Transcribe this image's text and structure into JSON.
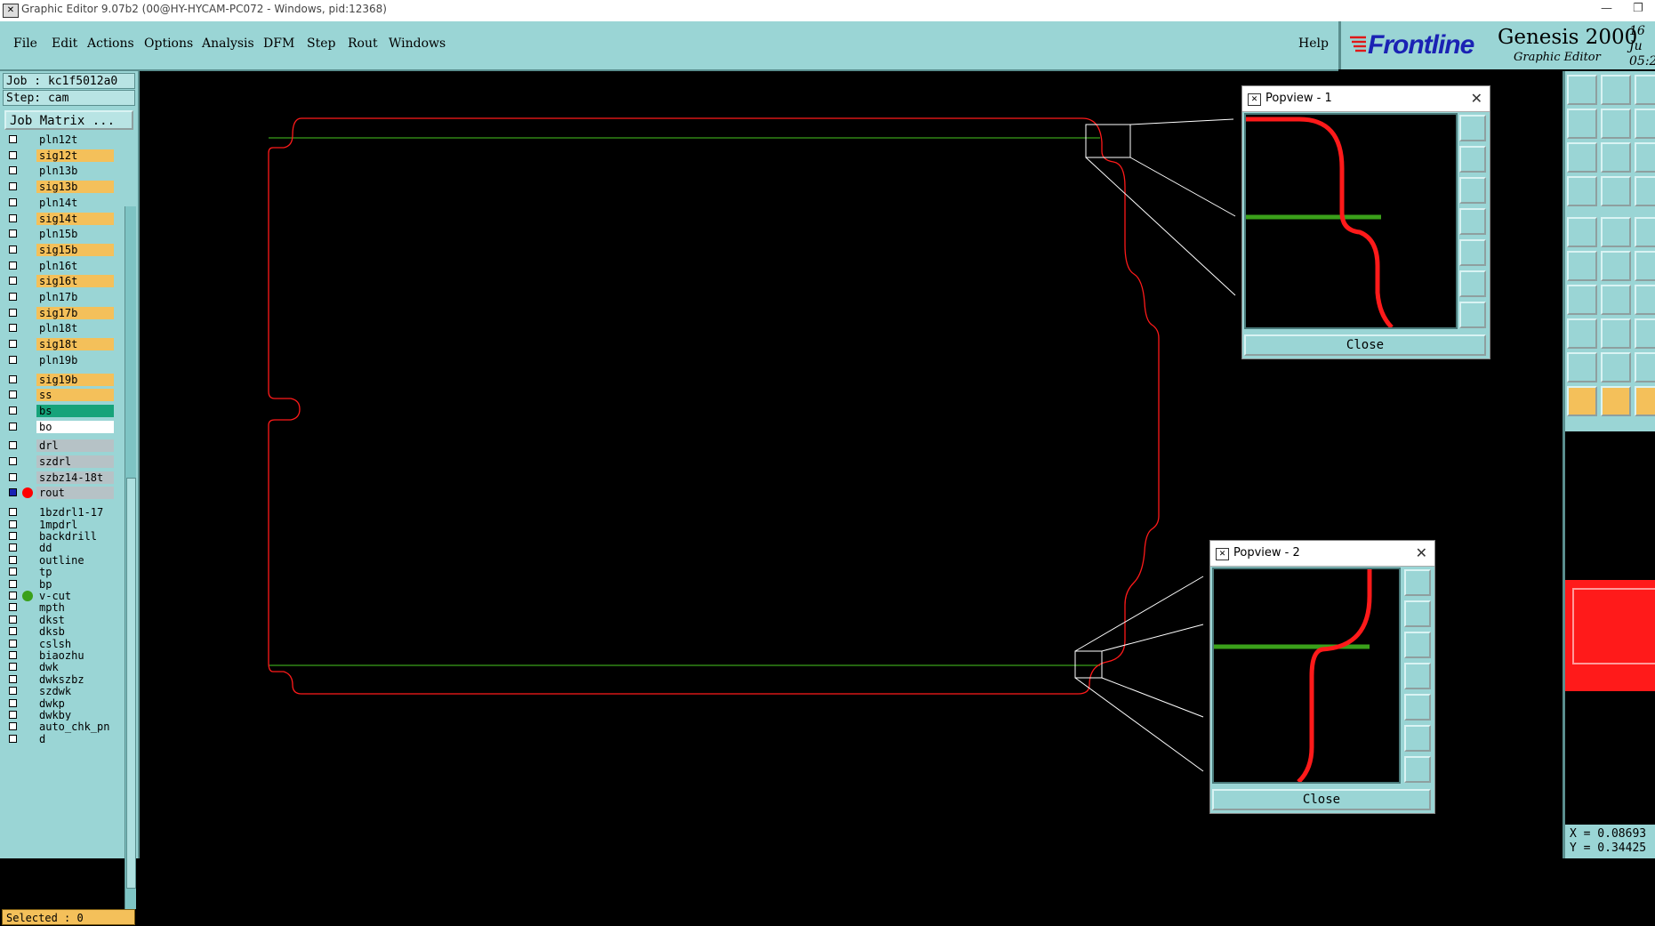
{
  "window": {
    "title": "Graphic Editor 9.07b2 (00@HY-HYCAM-PC072 - Windows, pid:12368)",
    "controls": [
      "—",
      "❐"
    ]
  },
  "menu": {
    "items": [
      "File",
      "Edit",
      "Actions",
      "Options",
      "Analysis",
      "DFM",
      "Step",
      "Rout",
      "Windows"
    ],
    "help": "Help"
  },
  "brand": {
    "logo": "Frontline",
    "product": "Genesis 2000",
    "subtitle": "Graphic Editor",
    "date_line1": "16 Ju",
    "date_line2": "05:2"
  },
  "job": {
    "job_label": "Job : kc1f5012a0",
    "step_label": "Step: cam",
    "matrix_button": "Job Matrix ..."
  },
  "layers": [
    {
      "name": "pln12t",
      "color": "#9ad5d5"
    },
    {
      "name": "sig12t",
      "color": "#f4c05a"
    },
    {
      "name": "pln13b",
      "color": "#9ad5d5"
    },
    {
      "name": "sig13b",
      "color": "#f4c05a"
    },
    {
      "name": "pln14t",
      "color": "#9ad5d5"
    },
    {
      "name": "sig14t",
      "color": "#f4c05a"
    },
    {
      "name": "pln15b",
      "color": "#9ad5d5"
    },
    {
      "name": "sig15b",
      "color": "#f4c05a"
    },
    {
      "name": "pln16t",
      "color": "#9ad5d5"
    },
    {
      "name": "sig16t",
      "color": "#f4c05a"
    },
    {
      "name": "pln17b",
      "color": "#9ad5d5"
    },
    {
      "name": "sig17b",
      "color": "#f4c05a"
    },
    {
      "name": "pln18t",
      "color": "#9ad5d5"
    },
    {
      "name": "sig18t",
      "color": "#f4c05a"
    },
    {
      "name": "pln19b",
      "color": "#9ad5d5"
    },
    {
      "name": "sig19b",
      "color": "#f4c05a"
    },
    {
      "name": "ss",
      "color": "#f4c05a"
    },
    {
      "name": "bs",
      "color": "#16a37a"
    },
    {
      "name": "bo",
      "color": "#ffffff"
    },
    {
      "name": "drl",
      "color": "#b6c2c6"
    },
    {
      "name": "szdrl",
      "color": "#b6c2c6"
    },
    {
      "name": "szbz14-18t",
      "color": "#b6c2c6"
    },
    {
      "name": "rout",
      "color": "#b6c2c6",
      "marker": "#ff0000",
      "active": true
    },
    {
      "name": "1bzdrl1-17",
      "color": "#9ad5d5"
    },
    {
      "name": "1mpdrl",
      "color": "#9ad5d5"
    },
    {
      "name": "backdrill",
      "color": "#9ad5d5"
    },
    {
      "name": "dd",
      "color": "#9ad5d5"
    },
    {
      "name": "outline",
      "color": "#9ad5d5"
    },
    {
      "name": "tp",
      "color": "#9ad5d5"
    },
    {
      "name": "bp",
      "color": "#9ad5d5"
    },
    {
      "name": "v-cut",
      "color": "#9ad5d5",
      "marker": "#3aa01a"
    },
    {
      "name": "mpth",
      "color": "#9ad5d5"
    },
    {
      "name": "dkst",
      "color": "#9ad5d5"
    },
    {
      "name": "dksb",
      "color": "#9ad5d5"
    },
    {
      "name": "cslsh",
      "color": "#9ad5d5"
    },
    {
      "name": "biaozhu",
      "color": "#9ad5d5"
    },
    {
      "name": "dwk",
      "color": "#9ad5d5"
    },
    {
      "name": "dwkszbz",
      "color": "#9ad5d5"
    },
    {
      "name": "szdwk",
      "color": "#9ad5d5"
    },
    {
      "name": "dwkp",
      "color": "#9ad5d5"
    },
    {
      "name": "dwkby",
      "color": "#9ad5d5"
    },
    {
      "name": "auto_chk_pn",
      "color": "#9ad5d5"
    },
    {
      "name": "d",
      "color": "#9ad5d5"
    }
  ],
  "status": {
    "selected": "Selected : 0"
  },
  "popview1": {
    "title": "Popview - 1",
    "close": "Close"
  },
  "popview2": {
    "title": "Popview - 2",
    "close": "Close"
  },
  "coords": {
    "x": "X = 0.08693",
    "y": "Y = 0.34425"
  },
  "colors": {
    "panel": "#9ad5d5",
    "rout": "#ff1a1a",
    "vcut": "#3aa01a",
    "highlight": "#f4c05a"
  }
}
